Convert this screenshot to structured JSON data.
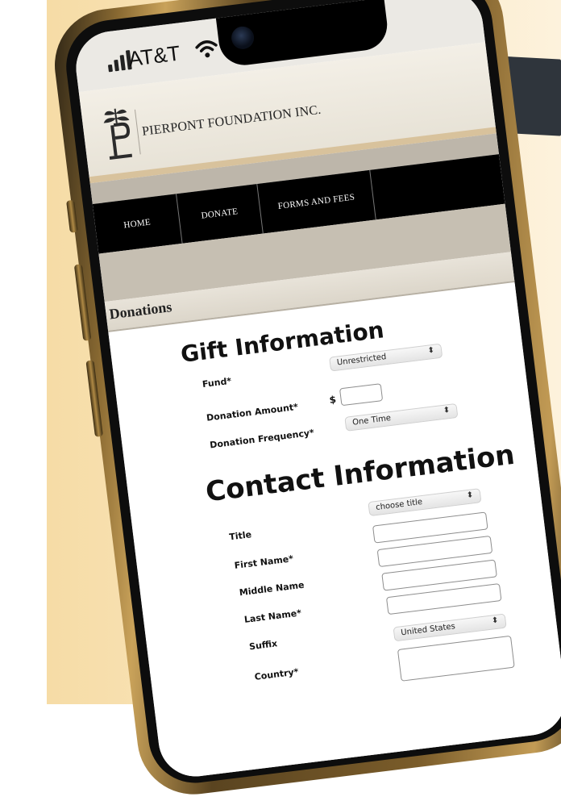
{
  "status_bar": {
    "carrier": "AT&T"
  },
  "site": {
    "name": "PIERPONT FOUNDATION INC."
  },
  "nav": {
    "items": [
      {
        "label": "HOME"
      },
      {
        "label": "DONATE"
      },
      {
        "label": "FORMS AND FEES"
      }
    ]
  },
  "page": {
    "title": "Donations"
  },
  "gift": {
    "heading": "Gift Information",
    "fund_label": "Fund*",
    "fund_value": "Unrestricted",
    "amount_label": "Donation Amount*",
    "currency": "$",
    "amount_value": "",
    "frequency_label": "Donation Frequency*",
    "frequency_value": "One Time"
  },
  "contact": {
    "heading": "Contact Information",
    "title_label": "Title",
    "title_value": "choose title",
    "first_name_label": "First Name*",
    "middle_name_label": "Middle Name",
    "last_name_label": "Last Name*",
    "suffix_label": "Suffix",
    "country_label": "Country*",
    "country_value": "United States"
  },
  "colors": {
    "gold_frame": "#c9a25a",
    "background": "#fae6bf",
    "nav_bg": "#000000"
  }
}
